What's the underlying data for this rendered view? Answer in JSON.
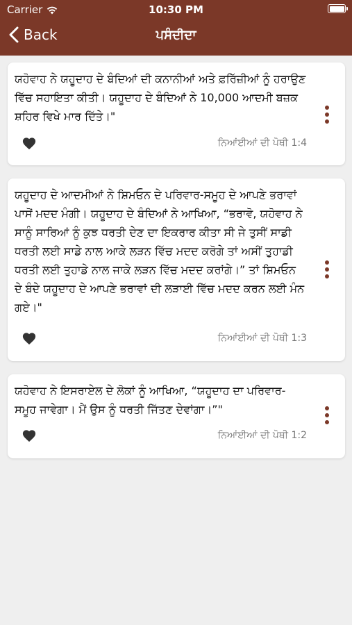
{
  "status_bar": {
    "carrier": "Carrier",
    "time": "10:30 PM"
  },
  "nav": {
    "back_label": "Back",
    "title": "ਪਸੰਦੀਦਾ"
  },
  "colors": {
    "header": "#7b3828",
    "accent": "#7b3828"
  },
  "cards": [
    {
      "text": "ਯਹੋਵਾਹ ਨੇ ਯਹੂਦਾਹ ਦੇ ਬੰਦਿਆਂ ਦੀ ਕਨਾਨੀਆਂ ਅਤੇ ਫ਼ਰਿੱਜ਼ੀਆਂ ਨੂੰ ਹਰਾਉਣ ਵਿੱਚ ਸਹਾਇਤਾ ਕੀਤੀ। ਯਹੂਦਾਹ ਦੇ ਬੰਦਿਆਂ ਨੇ 10,000 ਆਦਮੀ ਬਜ਼ਕ ਸ਼ਹਿਰ ਵਿਖੇ ਮਾਰ ਦਿੱਤੇ।\"",
      "reference": "ਨਿਆਂਈਆਂ ਦੀ ਪੋਥੀ 1:4"
    },
    {
      "text": "ਯਹੂਦਾਹ ਦੇ ਆਦਮੀਆਂ ਨੇ ਸ਼ਿਮਓਨ ਦੇ ਪਰਿਵਾਰ-ਸਮੂਹ ਦੇ ਆਪਣੇ ਭਰਾਵਾਂ ਪਾਸੋਂ ਮਦਦ ਮੰਗੀ। ਯਹੂਦਾਹ ਦੇ ਬੰਦਿਆਂ ਨੇ ਆਖਿਆ, “ਭਰਾਵੋ, ਯਹੋਵਾਹ ਨੇ ਸਾਨੂੰ ਸਾਰਿਆਂ ਨੂੰ ਕੁਝ ਧਰਤੀ ਦੇਣ ਦਾ ਇਕਰਾਰ ਕੀਤਾ ਸੀ ਜੇ ਤੁਸੀਂ ਸਾਡੀ ਧਰਤੀ ਲਈ ਸਾਡੇ ਨਾਲ ਆਕੇ ਲੜਨ ਵਿੱਚ ਮਦਦ ਕਰੋਗੇ ਤਾਂ ਅਸੀਂ ਤੁਹਾਡੀ ਧਰਤੀ ਲਈ ਤੁਹਾਡੇ ਨਾਲ ਜਾਕੇ ਲੜਨ ਵਿੱਚ ਮਦਦ ਕਰਾਂਗੇ।” ਤਾਂ ਸ਼ਿਮਓਨ ਦੇ ਬੰਦੇ ਯਹੂਦਾਹ ਦੇ ਆਪਣੇ ਭਰਾਵਾਂ ਦੀ ਲੜਾਈ ਵਿੱਚ ਮਦਦ ਕਰਨ ਲਈ ਮੰਨ ਗਏ।\"",
      "reference": "ਨਿਆਂਈਆਂ ਦੀ ਪੋਥੀ 1:3"
    },
    {
      "text": "ਯਹੋਵਾਹ ਨੇ ਇਸਰਾਏਲ ਦੇ ਲੋਕਾਂ ਨੂੰ ਆਖਿਆ, “ਯਹੂਦਾਹ ਦਾ ਪਰਿਵਾਰ-ਸਮੂਹ ਜਾਵੇਗਾ। ਮੈਂ ਉਸ ਨੂੰ ਧਰਤੀ ਜਿੱਤਣ ਦੇਵਾਂਗਾ।”\"",
      "reference": "ਨਿਆਂਈਆਂ ਦੀ ਪੋਥੀ 1:2"
    }
  ]
}
